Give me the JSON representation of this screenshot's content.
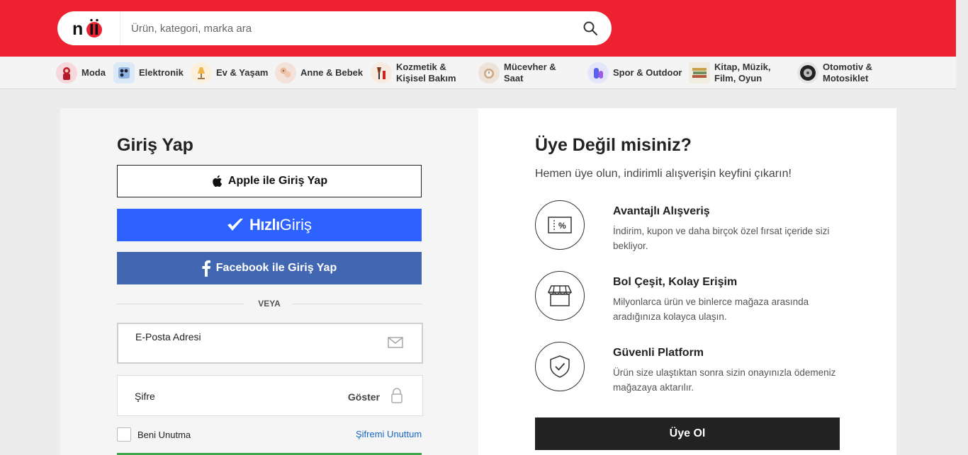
{
  "header": {
    "logo_text": "n11",
    "search_placeholder": "Ürün, kategori, marka ara"
  },
  "categories": [
    {
      "label": "Moda",
      "icon": "fashion-icon"
    },
    {
      "label": "Elektronik",
      "icon": "electronics-icon"
    },
    {
      "label": "Ev & Yaşam",
      "icon": "home-lamp-icon"
    },
    {
      "label": "Anne & Bebek",
      "icon": "baby-icon"
    },
    {
      "label": "Kozmetik &\nKişisel Bakım",
      "icon": "cosmetics-icon"
    },
    {
      "label": "Mücevher &\nSaat",
      "icon": "watch-icon"
    },
    {
      "label": "Spor & Outdoor",
      "icon": "sport-icon"
    },
    {
      "label": "Kitap, Müzik,\nFilm, Oyun",
      "icon": "books-icon"
    },
    {
      "label": "Otomotiv &\nMotosiklet",
      "icon": "tire-icon"
    }
  ],
  "login": {
    "title": "Giriş Yap",
    "apple_label": "Apple ile Giriş Yap",
    "hizli_strong": "Hızlı",
    "hizli_light": "Giriş",
    "facebook_label": "Facebook ile Giriş Yap",
    "or_text": "VEYA",
    "email_label": "E-Posta Adresi",
    "password_label": "Şifre",
    "show_label": "Göster",
    "remember_label": "Beni Unutma",
    "forgot_label": "Şifremi Unuttum"
  },
  "signup": {
    "title": "Üye Değil misiniz?",
    "subtitle": "Hemen üye olun, indirimli alışverişin keyfini çıkarın!",
    "features": [
      {
        "title": "Avantajlı Alışveriş",
        "desc": "İndirim, kupon ve daha birçok özel fırsat içeride sizi bekliyor.",
        "icon": "coupon-icon"
      },
      {
        "title": "Bol Çeşit, Kolay Erişim",
        "desc": "Milyonlarca ürün ve binlerce mağaza arasında aradığınıza kolayca ulaşın.",
        "icon": "store-icon"
      },
      {
        "title": "Güvenli Platform",
        "desc": "Ürün size ulaştıktan sonra sizin onayınızla ödemeniz mağazaya aktarılır.",
        "icon": "shield-check-icon"
      }
    ],
    "button_label": "Üye Ol"
  },
  "colors": {
    "brand_red": "#ee2131",
    "hizli_blue": "#2d62ff",
    "facebook_blue": "#4267b2",
    "link_blue": "#1666c8",
    "dark_button": "#222222"
  }
}
